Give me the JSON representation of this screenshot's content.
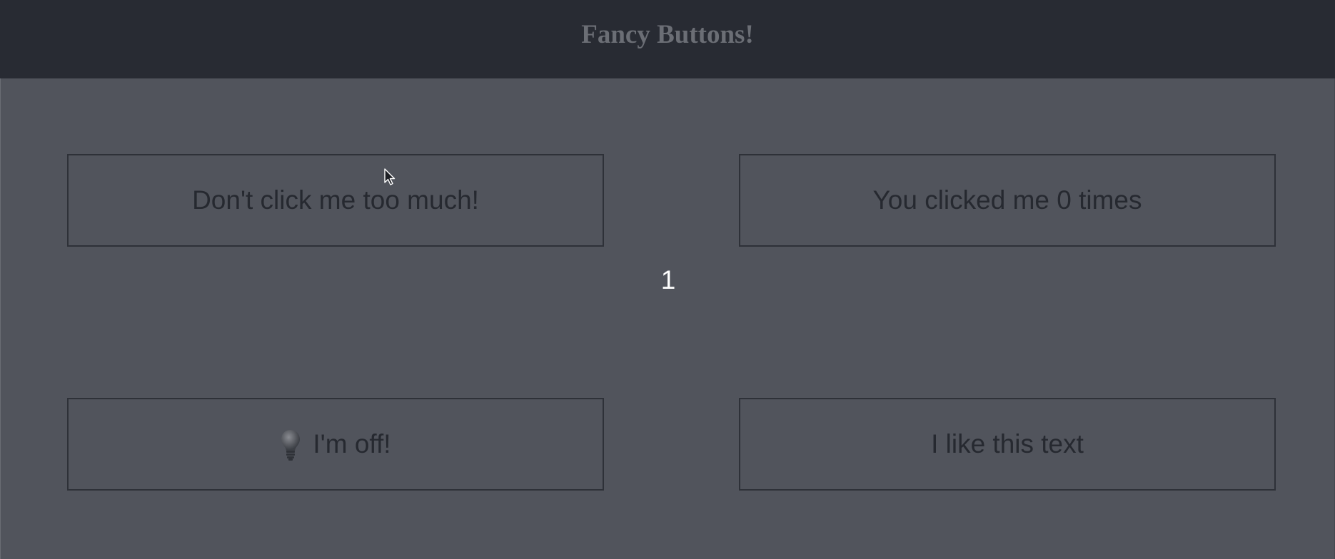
{
  "header": {
    "title": "Fancy Buttons!"
  },
  "buttons": {
    "dont_click": "Don't click me too much!",
    "clicked_times": "You clicked me 0 times",
    "light_toggle": "I'm off!",
    "like_text": "I like this text"
  },
  "counter": "1",
  "icons": {
    "light_toggle_icon": "lightbulb-icon",
    "cursor": "mouse-pointer-icon"
  },
  "colors": {
    "header_bg": "#282b33",
    "header_text": "#6b6e75",
    "page_bg": "#51545c",
    "button_border": "#2e3138",
    "button_text": "#262930",
    "counter_text": "#ffffff"
  }
}
